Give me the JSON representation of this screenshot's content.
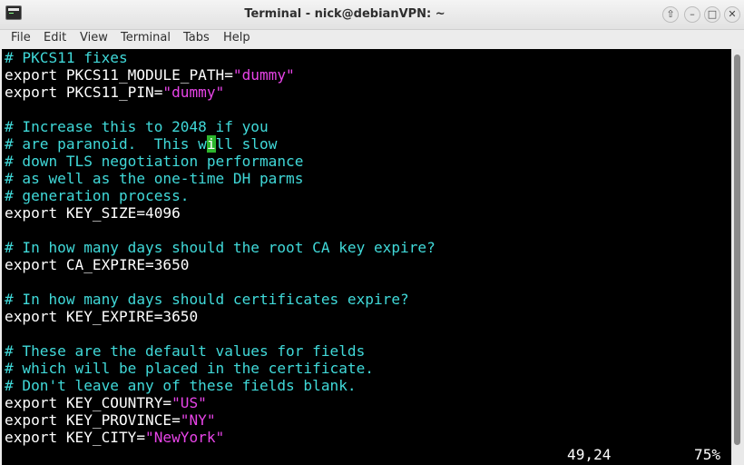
{
  "window": {
    "title": "Terminal - nick@debianVPN: ~"
  },
  "window_controls": {
    "up": "⇧",
    "min": "–",
    "max": "□",
    "close": "✕"
  },
  "menu": [
    "File",
    "Edit",
    "View",
    "Terminal",
    "Tabs",
    "Help"
  ],
  "terminal": {
    "lines": [
      [
        {
          "t": "# PKCS11 fixes",
          "k": "c"
        }
      ],
      [
        {
          "t": "export PKCS11_MODULE_PATH=",
          "k": "w"
        },
        {
          "t": "\"dummy\"",
          "k": "s"
        }
      ],
      [
        {
          "t": "export PKCS11_PIN=",
          "k": "w"
        },
        {
          "t": "\"dummy\"",
          "k": "s"
        }
      ],
      [],
      [
        {
          "t": "# Increase this to 2048 if you",
          "k": "c"
        }
      ],
      [
        {
          "t": "# are paranoid.  This w",
          "k": "c"
        },
        {
          "t": "i",
          "k": "cursor"
        },
        {
          "t": "ll slow",
          "k": "c"
        }
      ],
      [
        {
          "t": "# down TLS negotiation performance",
          "k": "c"
        }
      ],
      [
        {
          "t": "# as well as the one-time DH parms",
          "k": "c"
        }
      ],
      [
        {
          "t": "# generation process.",
          "k": "c"
        }
      ],
      [
        {
          "t": "export KEY_SIZE=4096",
          "k": "w"
        }
      ],
      [],
      [
        {
          "t": "# In how many days should the root CA key expire?",
          "k": "c"
        }
      ],
      [
        {
          "t": "export CA_EXPIRE=3650",
          "k": "w"
        }
      ],
      [],
      [
        {
          "t": "# In how many days should certificates expire?",
          "k": "c"
        }
      ],
      [
        {
          "t": "export KEY_EXPIRE=3650",
          "k": "w"
        }
      ],
      [],
      [
        {
          "t": "# These are the default values for fields",
          "k": "c"
        }
      ],
      [
        {
          "t": "# which will be placed in the certificate.",
          "k": "c"
        }
      ],
      [
        {
          "t": "# Don't leave any of these fields blank.",
          "k": "c"
        }
      ],
      [
        {
          "t": "export KEY_COUNTRY=",
          "k": "w"
        },
        {
          "t": "\"US\"",
          "k": "s"
        }
      ],
      [
        {
          "t": "export KEY_PROVINCE=",
          "k": "w"
        },
        {
          "t": "\"NY\"",
          "k": "s"
        }
      ],
      [
        {
          "t": "export KEY_CITY=",
          "k": "w"
        },
        {
          "t": "\"NewYork\"",
          "k": "s"
        }
      ]
    ],
    "status": {
      "position": "49,24",
      "percent": "75%"
    }
  },
  "colors": {
    "comment": "#40d9d9",
    "text": "#ffffff",
    "string": "#e844e8",
    "cursor": "#2db52d",
    "background": "#000000"
  },
  "icons": {
    "app": "terminal-icon"
  }
}
